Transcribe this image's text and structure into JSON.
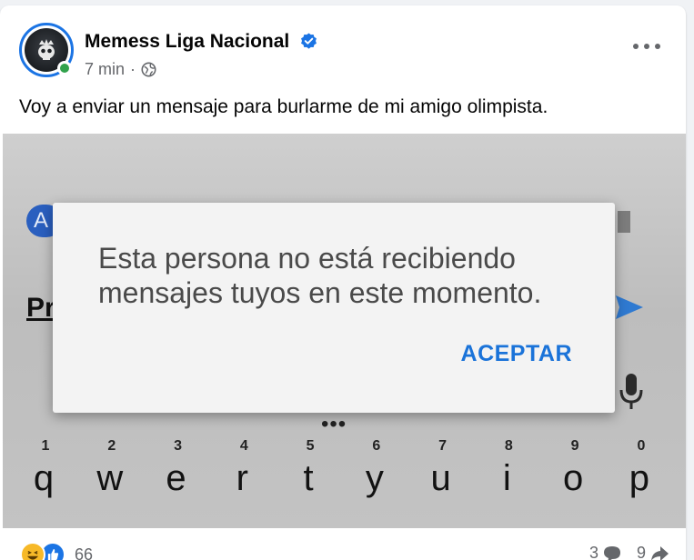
{
  "post": {
    "page_name": "Memess Liga Nacional",
    "time": "7 min",
    "separator": "·",
    "caption": "Voy a enviar un mensaje para burlarme de mi amigo olimpista."
  },
  "image": {
    "background_pill": "A",
    "background_text": "Pr",
    "keyboard_numbers": [
      "1",
      "2",
      "3",
      "4",
      "5",
      "6",
      "7",
      "8",
      "9",
      "0"
    ],
    "keyboard_letters": [
      "q",
      "w",
      "e",
      "r",
      "t",
      "y",
      "u",
      "i",
      "o",
      "p"
    ],
    "dialog_message": "Esta persona no está recibiendo mensajes tuyos en este momento.",
    "dialog_button": "ACEPTAR"
  },
  "footer": {
    "reaction_count": "66",
    "comment_count": "3",
    "share_count": "9"
  },
  "colors": {
    "verified": "#1b74e4",
    "online": "#31a24c",
    "accept": "#1a73d9"
  }
}
